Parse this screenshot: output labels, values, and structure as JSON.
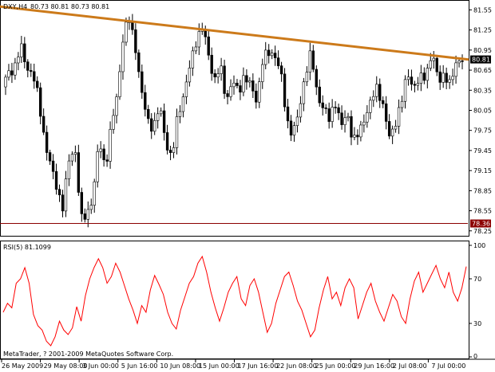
{
  "window": {
    "symbol_label": "DXY,H4",
    "ohlc": "80.73 80.81 80.73 80.81",
    "current_price": "80.81",
    "support_label": "78.36",
    "copyright": "MetaTrader, ? 2001-2009 MetaQuotes Software Corp."
  },
  "price_axis": {
    "ticks": [
      "81.55",
      "81.25",
      "80.95",
      "80.65",
      "80.35",
      "80.05",
      "79.75",
      "79.45",
      "79.15",
      "78.85",
      "78.55",
      "78.25"
    ]
  },
  "rsi_panel": {
    "label": "RSI(5) 81.1099",
    "ticks": [
      "100",
      "70",
      "30",
      "0"
    ]
  },
  "time_axis": {
    "labels": [
      "26 May 2009",
      "29 May 08:00",
      "3 Jun 00:00",
      "5 Jun 16:00",
      "10 Jun 08:00",
      "15 Jun 00:00",
      "17 Jun 16:00",
      "22 Jun 08:00",
      "25 Jun 00:00",
      "29 Jun 16:00",
      "2 Jul 08:00",
      "7 Jul 00:00"
    ]
  },
  "colors": {
    "trendline": "#cc7a1a",
    "support": "#8b0000",
    "rsi_line": "#ff0000",
    "price_tag": "#000000",
    "support_tag": "#8b0000"
  },
  "chart_data": [
    {
      "type": "candlestick",
      "title": "DXY,H4",
      "ylim": [
        78.2,
        81.65
      ],
      "ticks": [
        81.55,
        81.25,
        80.95,
        80.65,
        80.35,
        80.05,
        79.75,
        79.45,
        79.15,
        78.85,
        78.55,
        78.25
      ],
      "x": [
        "26 May 2009",
        "29 May 08:00",
        "3 Jun 00:00",
        "5 Jun 16:00",
        "10 Jun 08:00",
        "15 Jun 00:00",
        "17 Jun 16:00",
        "22 Jun 08:00",
        "25 Jun 00:00",
        "29 Jun 16:00",
        "2 Jul 08:00",
        "7 Jul 00:00"
      ],
      "close_path": [
        80.4,
        80.6,
        80.7,
        81.0,
        80.7,
        80.6,
        80.2,
        79.6,
        79.2,
        78.9,
        78.6,
        79.3,
        79.5,
        78.4,
        78.5,
        78.8,
        79.6,
        79.2,
        79.8,
        80.3,
        81.2,
        81.4,
        81.0,
        80.3,
        79.9,
        79.8,
        80.1,
        79.6,
        79.3,
        80.0,
        80.3,
        80.7,
        81.1,
        81.3,
        80.9,
        80.5,
        80.7,
        80.2,
        80.5,
        80.3,
        80.6,
        80.4,
        80.2,
        80.8,
        80.9,
        80.9,
        80.6,
        79.9,
        79.7,
        80.0,
        80.6,
        80.9,
        80.3,
        80.1,
        79.9,
        80.2,
        79.8,
        80.0,
        79.6,
        79.7,
        80.0,
        80.2,
        80.4,
        80.1,
        79.6,
        79.9,
        80.2,
        80.6,
        80.4,
        80.5,
        80.6,
        80.9,
        80.5,
        80.6,
        80.4,
        80.8,
        80.81
      ],
      "series": [
        {
          "name": "trendline",
          "values": [
            81.6,
            80.81
          ]
        },
        {
          "name": "support",
          "values": [
            78.36,
            78.36
          ]
        }
      ]
    },
    {
      "type": "line",
      "title": "RSI(5) 81.1099",
      "ylim": [
        0,
        100
      ],
      "ticks": [
        100,
        70,
        30,
        0
      ],
      "series": [
        {
          "name": "RSI(5)",
          "values": [
            40,
            48,
            44,
            66,
            70,
            80,
            66,
            38,
            28,
            24,
            14,
            10,
            18,
            32,
            24,
            20,
            26,
            45,
            32,
            55,
            70,
            80,
            88,
            80,
            66,
            72,
            84,
            76,
            64,
            52,
            42,
            30,
            46,
            40,
            60,
            73,
            65,
            56,
            40,
            30,
            25,
            42,
            54,
            66,
            72,
            84,
            90,
            76,
            58,
            44,
            32,
            44,
            58,
            66,
            72,
            52,
            46,
            64,
            70,
            58,
            40,
            22,
            30,
            48,
            60,
            72,
            76,
            64,
            50,
            42,
            30,
            18,
            24,
            44,
            60,
            72,
            52,
            58,
            46,
            62,
            70,
            62,
            34,
            46,
            58,
            66,
            50,
            40,
            32,
            44,
            56,
            50,
            36,
            30,
            52,
            68,
            76,
            58,
            66,
            74,
            82,
            70,
            62,
            76,
            58,
            50,
            62,
            81
          ]
        }
      ]
    }
  ]
}
